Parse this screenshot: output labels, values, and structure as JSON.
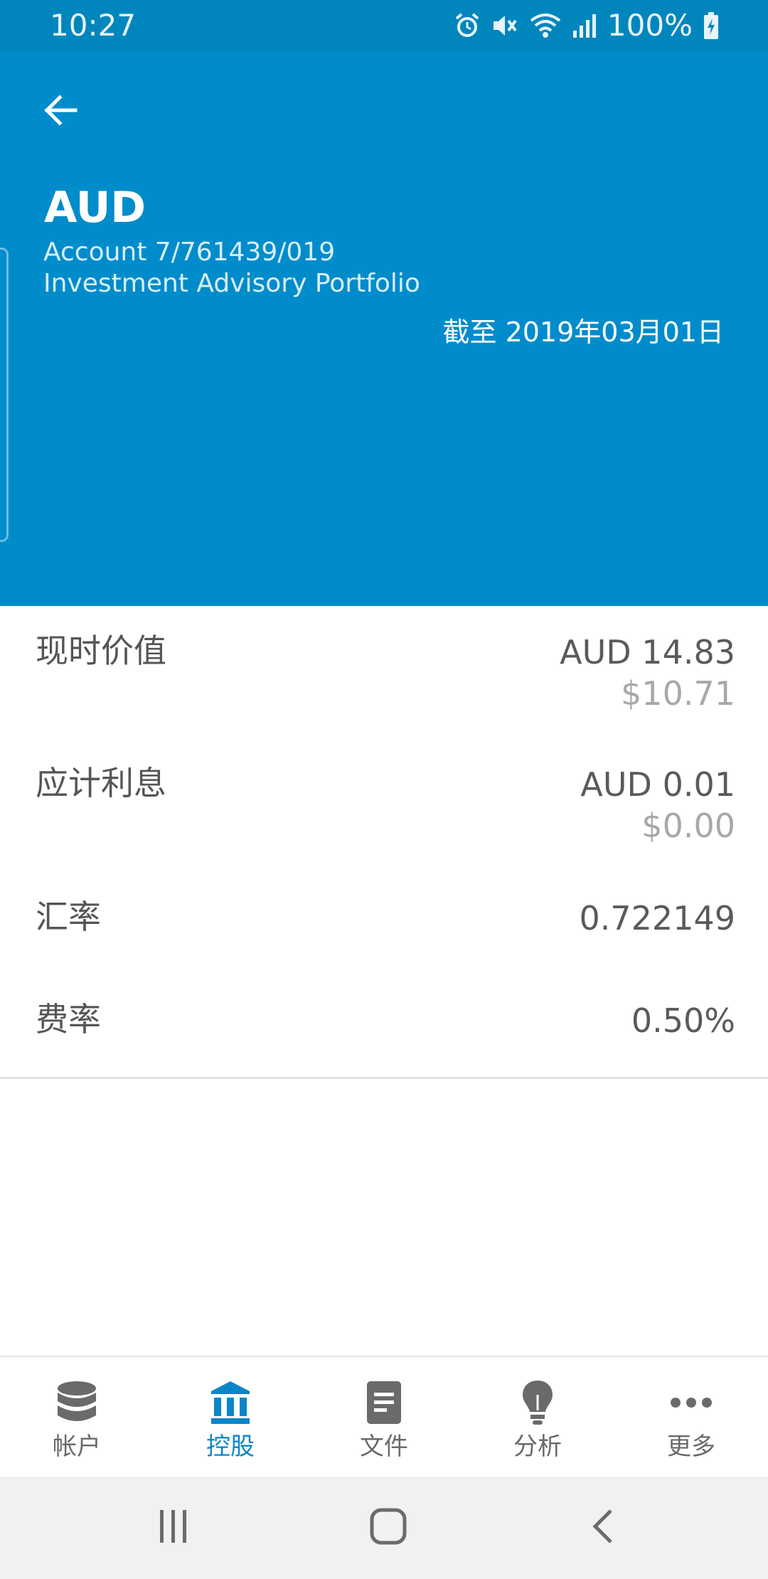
{
  "status_bar": {
    "time": "10:27",
    "battery": "100%",
    "icons": [
      "alarm-icon",
      "mute-icon",
      "wifi-icon",
      "signal-icon",
      "battery-charging-icon"
    ]
  },
  "header": {
    "back_icon": "arrow-left-icon",
    "currency": "AUD",
    "account": "Account 7/761439/019",
    "portfolio": "Investment Advisory Portfolio",
    "as_of": "截至 2019年03月01日",
    "background_color": "#008ccb"
  },
  "details": [
    {
      "label": "现时价值",
      "value": "AUD 14.83",
      "sub_value": "$10.71"
    },
    {
      "label": "应计利息",
      "value": "AUD 0.01",
      "sub_value": "$0.00"
    },
    {
      "label": "汇率",
      "value": "0.722149"
    },
    {
      "label": "费率",
      "value": "0.50%"
    }
  ],
  "bottom_nav": {
    "active_color": "#0a86c8",
    "items": [
      {
        "label": "帐户",
        "icon": "database-icon",
        "active": false
      },
      {
        "label": "控股",
        "icon": "bank-icon",
        "active": true
      },
      {
        "label": "文件",
        "icon": "document-icon",
        "active": false
      },
      {
        "label": "分析",
        "icon": "lightbulb-icon",
        "active": false
      },
      {
        "label": "更多",
        "icon": "more-dots-icon",
        "active": false
      }
    ]
  },
  "system_nav": {
    "icons": [
      "recents-icon",
      "home-icon",
      "back-icon"
    ]
  }
}
